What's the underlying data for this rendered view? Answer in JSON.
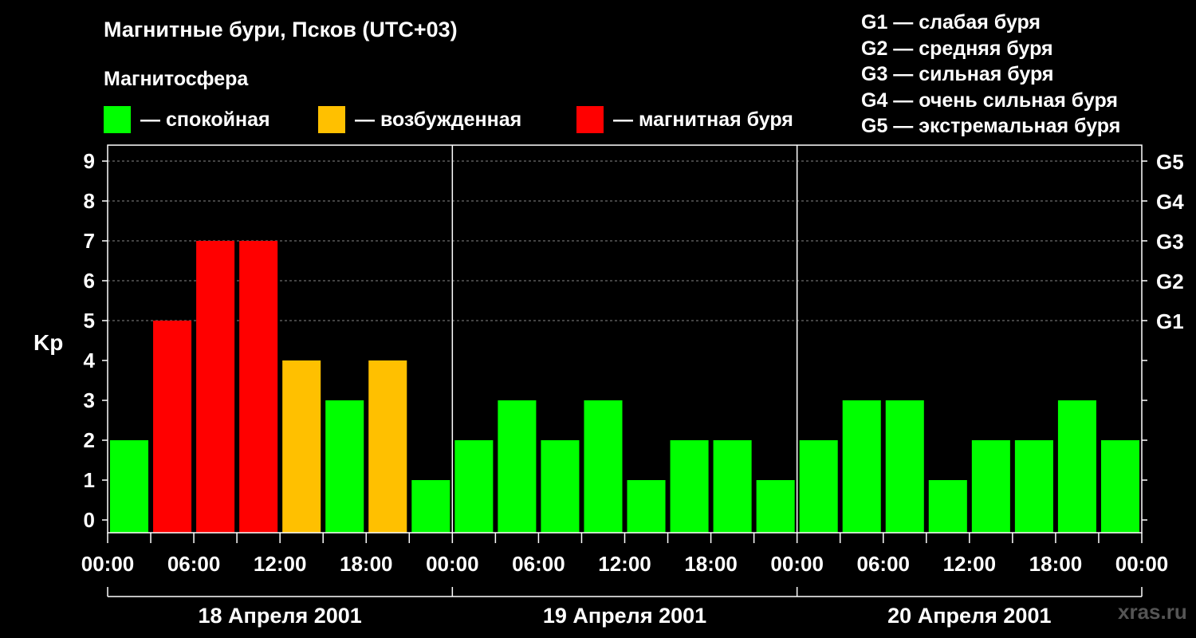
{
  "header": {
    "title": "Магнитные бури, Псков (UTC+03)",
    "subtitle": "Магнитосфера"
  },
  "legend": [
    {
      "label": "— спокойная",
      "color": "#00ff00"
    },
    {
      "label": "— возбужденная",
      "color": "#ffc000"
    },
    {
      "label": "— магнитная буря",
      "color": "#ff0000"
    }
  ],
  "storm_levels": [
    "G1 — слабая буря",
    "G2 — средняя буря",
    "G3 — сильная буря",
    "G4 — очень сильная буря",
    "G5 — экстремальная буря"
  ],
  "watermark": "xras.ru",
  "chart_data": {
    "type": "bar",
    "ylabel": "Kp",
    "ylim": [
      0,
      9
    ],
    "yticks": [
      "0",
      "1",
      "2",
      "3",
      "4",
      "5",
      "6",
      "7",
      "8",
      "9"
    ],
    "right_axis_labels": [
      {
        "y": 5,
        "label": "G1"
      },
      {
        "y": 6,
        "label": "G2"
      },
      {
        "y": 7,
        "label": "G3"
      },
      {
        "y": 8,
        "label": "G4"
      },
      {
        "y": 9,
        "label": "G5"
      }
    ],
    "grid": true,
    "xtick_labels": [
      "00:00",
      "06:00",
      "12:00",
      "18:00",
      "00:00",
      "06:00",
      "12:00",
      "18:00",
      "00:00",
      "06:00",
      "12:00",
      "18:00",
      "00:00"
    ],
    "days": [
      "18 Апреля 2001",
      "19 Апреля 2001",
      "20 Апреля 2001"
    ],
    "series": [
      {
        "values": [
          2,
          5,
          7,
          7,
          4,
          3,
          4,
          1,
          2,
          3,
          2,
          3,
          1,
          2,
          2,
          1,
          2,
          3,
          3,
          1,
          2,
          2,
          3,
          2
        ]
      }
    ],
    "colors": {
      "quiet": "#00ff00",
      "active": "#ffc000",
      "storm": "#ff0000"
    }
  }
}
